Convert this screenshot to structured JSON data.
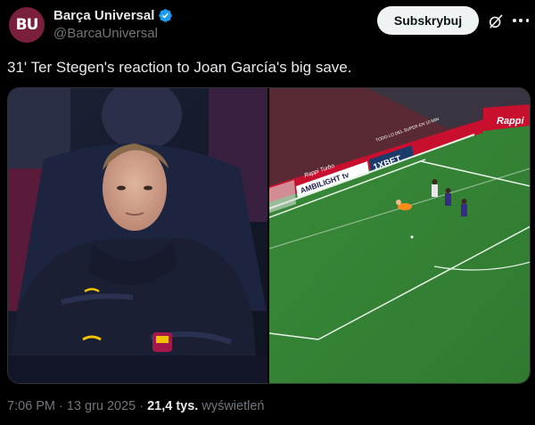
{
  "account": {
    "avatar_text": "BU",
    "display_name": "Barça Universal",
    "handle": "@BarcaUniversal",
    "verified": true
  },
  "actions": {
    "subscribe_label": "Subskrybuj",
    "grok_icon": "grok-icon",
    "more_icon": "more-icon"
  },
  "tweet": {
    "text": "31' Ter Stegen's reaction to Joan García's big save."
  },
  "media": {
    "left_image": "goalkeeper-on-bench",
    "right_image": "football-pitch-save",
    "ad_boards": [
      "Rappi Turbo",
      "AMBILIGHT tv",
      "1XBET",
      "TODO LO DEL SUPER EN 10 MIN",
      "Rappi"
    ]
  },
  "meta": {
    "time": "7:06 PM",
    "separator1": "·",
    "date": "13 gru 2025",
    "separator2": "·",
    "views_count": "21,4 tys.",
    "views_label": "wyświetleń"
  },
  "colors": {
    "background": "#000000",
    "text": "#e7e9ea",
    "muted": "#71767b",
    "verified": "#1d9bf0",
    "avatar": "#7a1f3c",
    "button": "#eff3f4"
  }
}
